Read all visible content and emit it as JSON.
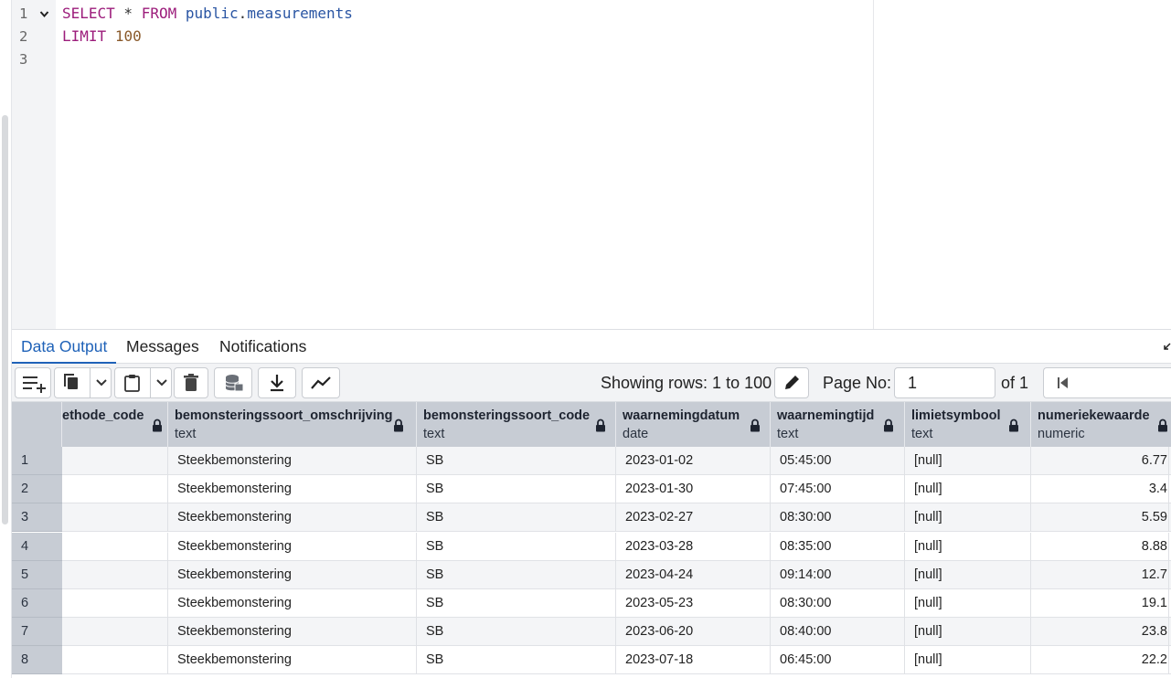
{
  "editor": {
    "lines": [
      {
        "num": "1",
        "tokens": [
          {
            "t": "SELECT",
            "c": "kw"
          },
          {
            "t": " * ",
            "c": "punct"
          },
          {
            "t": "FROM",
            "c": "kw"
          },
          {
            "t": " public",
            "c": "ident"
          },
          {
            "t": ".",
            "c": "punct"
          },
          {
            "t": "measurements",
            "c": "ident"
          }
        ]
      },
      {
        "num": "2",
        "tokens": [
          {
            "t": "LIMIT",
            "c": "kw"
          },
          {
            "t": " ",
            "c": "punct"
          },
          {
            "t": "100",
            "c": "numlit"
          }
        ]
      },
      {
        "num": "3",
        "tokens": []
      }
    ]
  },
  "tabs": [
    {
      "label": "Data Output",
      "active": true
    },
    {
      "label": "Messages",
      "active": false
    },
    {
      "label": "Notifications",
      "active": false
    }
  ],
  "toolbar": {
    "rows_label": "Showing rows: 1 to 100",
    "page_label": "Page No:",
    "page_value": "1",
    "of_label": "of 1",
    "icons": {
      "add_row": "add-row-icon",
      "copy": "copy-icon",
      "paste": "paste-icon",
      "delete": "delete-icon",
      "save_data": "save-data-icon",
      "download": "download-icon",
      "graph": "graph-visualiser-icon",
      "edit": "pencil-icon",
      "first": "first-page-icon",
      "prev": "previous-page-icon",
      "next": "next-page-icon"
    }
  },
  "grid": {
    "columns": [
      {
        "name": "ethode_code",
        "type": ""
      },
      {
        "name": "bemonsteringssoort_omschrijving",
        "type": "text"
      },
      {
        "name": "bemonsteringssoort_code",
        "type": "text"
      },
      {
        "name": "waarnemingdatum",
        "type": "date"
      },
      {
        "name": "waarnemingtijd",
        "type": "text"
      },
      {
        "name": "limietsymbool",
        "type": "text"
      },
      {
        "name": "numeriekewaarde",
        "type": "numeric"
      }
    ],
    "rows": [
      {
        "n": "1",
        "cells": [
          "",
          "Steekbemonstering",
          "SB",
          "2023-01-02",
          "05:45:00",
          "[null]",
          "6.77"
        ]
      },
      {
        "n": "2",
        "cells": [
          "",
          "Steekbemonstering",
          "SB",
          "2023-01-30",
          "07:45:00",
          "[null]",
          "3.4"
        ]
      },
      {
        "n": "3",
        "cells": [
          "",
          "Steekbemonstering",
          "SB",
          "2023-02-27",
          "08:30:00",
          "[null]",
          "5.59"
        ]
      },
      {
        "n": "4",
        "cells": [
          "",
          "Steekbemonstering",
          "SB",
          "2023-03-28",
          "08:35:00",
          "[null]",
          "8.88"
        ]
      },
      {
        "n": "5",
        "cells": [
          "",
          "Steekbemonstering",
          "SB",
          "2023-04-24",
          "09:14:00",
          "[null]",
          "12.7"
        ]
      },
      {
        "n": "6",
        "cells": [
          "",
          "Steekbemonstering",
          "SB",
          "2023-05-23",
          "08:30:00",
          "[null]",
          "19.1"
        ]
      },
      {
        "n": "7",
        "cells": [
          "",
          "Steekbemonstering",
          "SB",
          "2023-06-20",
          "08:40:00",
          "[null]",
          "23.8"
        ]
      },
      {
        "n": "8",
        "cells": [
          "",
          "Steekbemonstering",
          "SB",
          "2023-07-18",
          "06:45:00",
          "[null]",
          "22.2"
        ]
      }
    ]
  },
  "colors": {
    "keyword": "#9c1c7b",
    "identifier": "#2a55a3",
    "number": "#8a5a2b",
    "active_tab": "#1f62b8",
    "grid_header": "#c7ccd4"
  }
}
